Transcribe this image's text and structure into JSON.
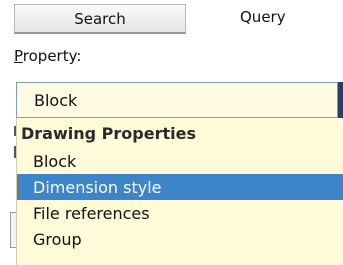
{
  "tabs": {
    "search_label": "Search",
    "query_label": "Query"
  },
  "property": {
    "label_first": "P",
    "label_rest": "roperty:",
    "selected_value": "Block"
  },
  "dropdown": {
    "group_header": "Drawing Properties",
    "options": [
      {
        "label": "Block",
        "selected": false
      },
      {
        "label": "Dimension style",
        "selected": true
      },
      {
        "label": "File references",
        "selected": false
      },
      {
        "label": "Group",
        "selected": false
      }
    ]
  },
  "colors": {
    "select_background": "#fffbe2",
    "highlight": "#3d84c9",
    "border": "#7f9db9"
  }
}
